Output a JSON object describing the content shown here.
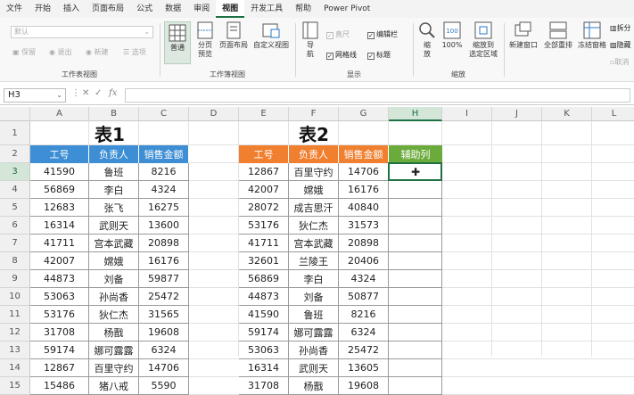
{
  "menu": [
    "文件",
    "开始",
    "插入",
    "页面布局",
    "公式",
    "数据",
    "审阅",
    "视图",
    "开发工具",
    "帮助",
    "Power Pivot"
  ],
  "menu_active_index": 7,
  "ribbon": {
    "sheet_view": {
      "dropdown": "默认",
      "keep": "保留",
      "exit": "退出",
      "new": "新建",
      "options": "选项",
      "label": "工作表视图"
    },
    "workbook_view": {
      "normal": "普通",
      "page_break": "分页\n预览",
      "page_layout": "页面布局",
      "custom": "自定义视图",
      "label": "工作簿视图"
    },
    "show": {
      "nav": "导\n航",
      "ruler": "直尺",
      "gridlines": "网格线",
      "formula_bar": "编辑栏",
      "headings": "标题",
      "label": "显示"
    },
    "zoom": {
      "zoom": "缩\n放",
      "hundred": "100%",
      "to_selection": "缩放到\n选定区域",
      "label": "缩放"
    },
    "window": {
      "new_window": "新建窗口",
      "arrange_all": "全部重排",
      "freeze": "冻结窗格",
      "split": "拆分",
      "hide": "隐藏",
      "unhide": "取消"
    }
  },
  "formula_bar": {
    "name_box": "H3",
    "fx": "fx"
  },
  "columns": [
    "A",
    "B",
    "C",
    "D",
    "E",
    "F",
    "G",
    "H",
    "I",
    "J",
    "K",
    "L"
  ],
  "rows": [
    "1",
    "2",
    "3",
    "4",
    "5",
    "6",
    "7",
    "8",
    "9",
    "10",
    "11",
    "12",
    "13",
    "14",
    "15"
  ],
  "active_cell": "H3",
  "table1": {
    "title": "表1",
    "headers": [
      "工号",
      "负责人",
      "销售金额"
    ],
    "rows": [
      [
        "41590",
        "鲁班",
        "8216"
      ],
      [
        "56869",
        "李白",
        "4324"
      ],
      [
        "12683",
        "张飞",
        "16275"
      ],
      [
        "16314",
        "武则天",
        "13600"
      ],
      [
        "41711",
        "宫本武藏",
        "20898"
      ],
      [
        "42007",
        "嫦娥",
        "16176"
      ],
      [
        "44873",
        "刘备",
        "59877"
      ],
      [
        "53063",
        "孙尚香",
        "25472"
      ],
      [
        "53176",
        "狄仁杰",
        "31565"
      ],
      [
        "31708",
        "杨戬",
        "19608"
      ],
      [
        "59174",
        "娜可露露",
        "6324"
      ],
      [
        "12867",
        "百里守约",
        "14706"
      ],
      [
        "15486",
        "猪八戒",
        "5590"
      ]
    ]
  },
  "table2": {
    "title": "表2",
    "headers": [
      "工号",
      "负责人",
      "销售金额",
      "辅助列"
    ],
    "rows": [
      [
        "12867",
        "百里守约",
        "14706",
        ""
      ],
      [
        "42007",
        "嫦娥",
        "16176",
        ""
      ],
      [
        "28072",
        "成吉思汗",
        "40840",
        ""
      ],
      [
        "53176",
        "狄仁杰",
        "31573",
        ""
      ],
      [
        "41711",
        "宫本武藏",
        "20898",
        ""
      ],
      [
        "32601",
        "兰陵王",
        "20406",
        ""
      ],
      [
        "56869",
        "李白",
        "4324",
        ""
      ],
      [
        "44873",
        "刘备",
        "50877",
        ""
      ],
      [
        "41590",
        "鲁班",
        "8216",
        ""
      ],
      [
        "59174",
        "娜可露露",
        "6324",
        ""
      ],
      [
        "53063",
        "孙尚香",
        "25472",
        ""
      ],
      [
        "16314",
        "武则天",
        "13605",
        ""
      ],
      [
        "31708",
        "杨戬",
        "19608",
        ""
      ]
    ]
  },
  "colors": {
    "header_blue": "#3d8ed4",
    "header_orange": "#f08030",
    "header_green": "#6bab3b",
    "accent": "#1e7145"
  }
}
